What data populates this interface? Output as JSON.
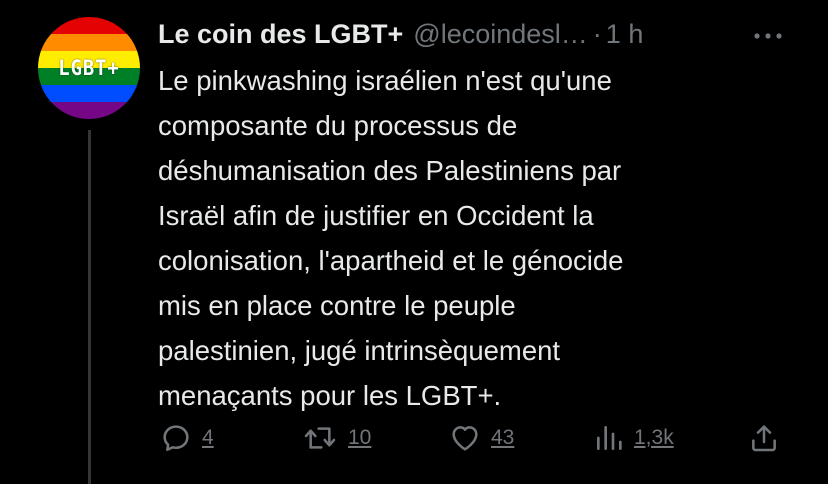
{
  "tweet": {
    "display_name": "Le coin des LGBT+",
    "handle": "@lecoindesl…",
    "separator": "·",
    "time": "1 h",
    "avatar_text": "LGBT+",
    "text_lines": [
      "Le pinkwashing israélien n'est qu'une",
      "composante du processus de",
      "déshumanisation des Palestiniens par",
      "Israël afin de justifier en Occident la",
      "colonisation, l'apartheid et le génocide",
      "mis en place contre le peuple",
      "palestinien, jugé intrinsèquement",
      "menaçants pour les LGBT+."
    ],
    "actions": {
      "replies": "4",
      "retweets": "10",
      "likes": "43",
      "views": "1,3k"
    }
  },
  "colors": {
    "background": "#000000",
    "text_primary": "#e7e9ea",
    "text_secondary": "#71767b",
    "thread_line": "#333639",
    "avatar_stripes": [
      "#e40303",
      "#ff8c00",
      "#ffed00",
      "#008026",
      "#004dff",
      "#750787"
    ]
  },
  "icons": {
    "reply": "reply-icon",
    "retweet": "retweet-icon",
    "like": "heart-icon",
    "views": "bar-chart-icon",
    "share": "share-icon",
    "more": "more-icon"
  }
}
